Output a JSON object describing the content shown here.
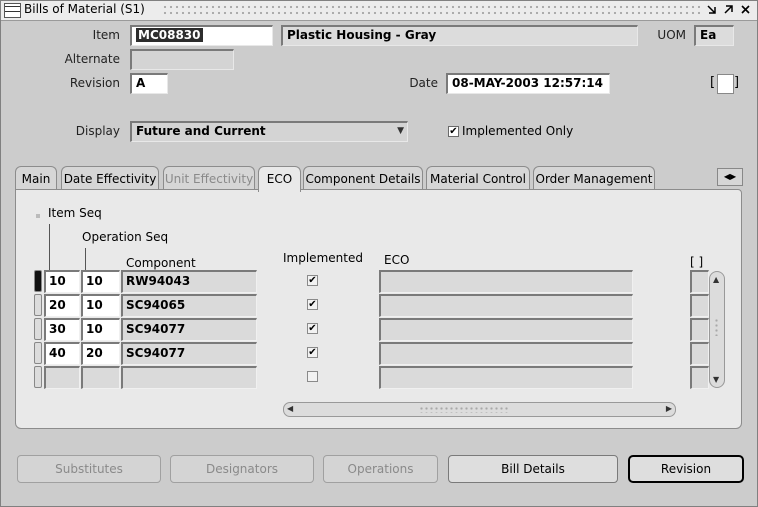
{
  "window": {
    "title": "Bills of Material (S1)",
    "controls": [
      "minimize-icon",
      "maximize-icon",
      "close-icon"
    ]
  },
  "header": {
    "item_label": "Item",
    "item_value": "MC08830",
    "item_description": "Plastic Housing - Gray",
    "uom_label": "UOM",
    "uom_value": "Ea",
    "alternate_label": "Alternate",
    "alternate_value": "",
    "revision_label": "Revision",
    "revision_value": "A",
    "date_label": "Date",
    "date_value": "08-MAY-2003 12:57:14",
    "bracket_field": "[ ]",
    "display_label": "Display",
    "display_value": "Future and Current",
    "implemented_only_label": "Implemented Only",
    "implemented_only_checked": true
  },
  "tabs": [
    {
      "label": "Main",
      "state": "normal"
    },
    {
      "label": "Date Effectivity",
      "state": "normal"
    },
    {
      "label": "Unit Effectivity",
      "state": "disabled"
    },
    {
      "label": "ECO",
      "state": "active"
    },
    {
      "label": "Component Details",
      "state": "normal"
    },
    {
      "label": "Material Control",
      "state": "normal"
    },
    {
      "label": "Order Management",
      "state": "normal"
    }
  ],
  "grid": {
    "col_item_seq": "Item Seq",
    "col_operation_seq": "Operation Seq",
    "col_component": "Component",
    "col_implemented": "Implemented",
    "col_eco": "ECO",
    "col_bracket": "[ ]",
    "rows": [
      {
        "item_seq": "10",
        "op_seq": "10",
        "component": "RW94043",
        "implemented": true,
        "eco": ""
      },
      {
        "item_seq": "20",
        "op_seq": "10",
        "component": "SC94065",
        "implemented": true,
        "eco": ""
      },
      {
        "item_seq": "30",
        "op_seq": "10",
        "component": "SC94077",
        "implemented": true,
        "eco": ""
      },
      {
        "item_seq": "40",
        "op_seq": "20",
        "component": "SC94077",
        "implemented": true,
        "eco": ""
      },
      {
        "item_seq": "",
        "op_seq": "",
        "component": "",
        "implemented": false,
        "eco": ""
      }
    ]
  },
  "buttons": {
    "substitutes": "Substitutes",
    "designators": "Designators",
    "operations": "Operations",
    "bill_details": "Bill Details",
    "revision": "Revision"
  },
  "colors": {
    "window_bg": "#cccccc",
    "panel_bg": "#e9e9e9",
    "field_bg": "#ffffff",
    "selection_bg": "#2d2d2d"
  }
}
